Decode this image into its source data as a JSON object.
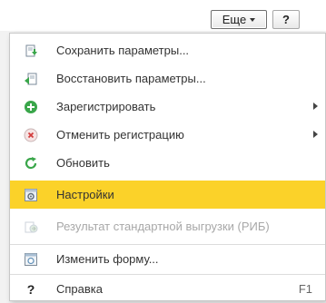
{
  "toolbar": {
    "more_label": "Еще",
    "help_label": "?"
  },
  "menu": {
    "items": [
      {
        "label": "Сохранить параметры...",
        "icon": "save-settings-icon"
      },
      {
        "label": "Восстановить параметры...",
        "icon": "restore-settings-icon"
      },
      {
        "label": "Зарегистрировать",
        "icon": "plus-circle-icon",
        "submenu": true
      },
      {
        "label": "Отменить регистрацию",
        "icon": "cancel-circle-icon",
        "submenu": true
      },
      {
        "label": "Обновить",
        "icon": "refresh-icon"
      },
      {
        "label": "Настройки",
        "icon": "settings-icon",
        "highlighted": true
      },
      {
        "label": "Результат стандартной выгрузки (РИБ)",
        "icon": "export-result-icon",
        "disabled": true
      },
      {
        "label": "Изменить форму...",
        "icon": "change-form-icon"
      },
      {
        "label": "Справка",
        "icon": "help-icon",
        "shortcut": "F1"
      }
    ]
  },
  "colors": {
    "highlight": "#fbd229",
    "accent_green": "#3aa64a",
    "cancel_red": "#d23b3b"
  }
}
